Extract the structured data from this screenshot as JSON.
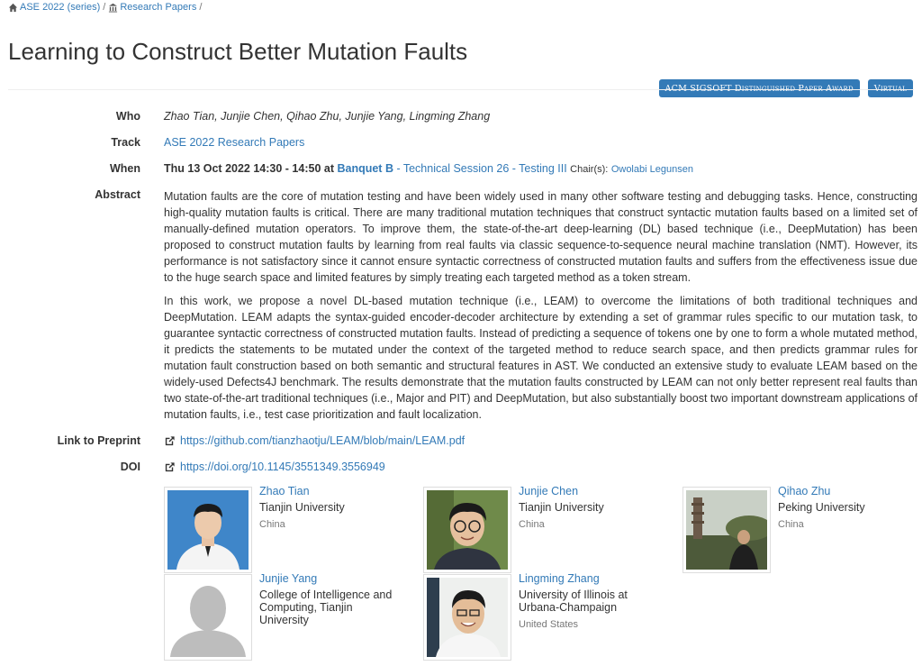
{
  "breadcrumb": {
    "series": "ASE 2022 (series)",
    "sep1": "/",
    "papers": "Research Papers",
    "sep2": "/"
  },
  "title": "Learning to Construct Better Mutation Faults",
  "badges": [
    "ACM SIGSOFT Distinguished Paper Award",
    "Virtual"
  ],
  "fields": {
    "who_label": "Who",
    "who": "Zhao Tian, Junjie Chen, Qihao Zhu, Junjie Yang, Lingming Zhang",
    "track_label": "Track",
    "track": "ASE 2022 Research Papers",
    "when_label": "When",
    "when_date": "Thu 13 Oct 2022 14:30 - 14:50 at",
    "when_room": "Banquet B",
    "when_dash": " - ",
    "when_session": "Technical Session 26 - Testing III",
    "chairs_label": "Chair(s):",
    "chair": "Owolabi Legunsen",
    "abstract_label": "Abstract",
    "preprint_label": "Link to Preprint",
    "preprint_url": "https://github.com/tianzhaotju/LEAM/blob/main/LEAM.pdf",
    "doi_label": "DOI",
    "doi_url": "https://doi.org/10.1145/3551349.3556949"
  },
  "abstract": [
    "Mutation faults are the core of mutation testing and have been widely used in many other software testing and debugging tasks. Hence, constructing high-quality mutation faults is critical. There are many traditional mutation techniques that construct syntactic mutation faults based on a limited set of manually-defined mutation operators. To improve them, the state-of-the-art deep-learning (DL) based technique (i.e., DeepMutation) has been proposed to construct mutation faults by learning from real faults via classic sequence-to-sequence neural machine translation (NMT). However, its performance is not satisfactory since it cannot ensure syntactic correctness of constructed mutation faults and suffers from the effectiveness issue due to the huge search space and limited features by simply treating each targeted method as a token stream.",
    "In this work, we propose a novel DL-based mutation technique (i.e., LEAM) to overcome the limitations of both traditional techniques and DeepMutation. LEAM adapts the syntax-guided encoder-decoder architecture by extending a set of grammar rules specific to our mutation task, to guarantee syntactic correctness of constructed mutation faults. Instead of predicting a sequence of tokens one by one to form a whole mutated method, it predicts the statements to be mutated under the context of the targeted method to reduce search space, and then predicts grammar rules for mutation fault construction based on both semantic and structural features in AST. We conducted an extensive study to evaluate LEAM based on the widely-used Defects4J benchmark. The results demonstrate that the mutation faults constructed by LEAM can not only better represent real faults than two state-of-the-art traditional techniques (i.e., Major and PIT) and DeepMutation, but also substantially boost two important downstream applications of mutation faults, i.e., test case prioritization and fault localization."
  ],
  "people": [
    {
      "name": "Zhao Tian",
      "affiliation": "Tianjin University",
      "country": "China"
    },
    {
      "name": "Junjie Chen",
      "affiliation": "Tianjin University",
      "country": "China"
    },
    {
      "name": "Qihao Zhu",
      "affiliation": "Peking University",
      "country": "China"
    },
    {
      "name": "Junjie Yang",
      "affiliation": "College of Intelligence and Computing, Tianjin University",
      "country": ""
    },
    {
      "name": "Lingming Zhang",
      "affiliation": "University of Illinois at Urbana-Champaign",
      "country": "United States"
    }
  ],
  "icons": {
    "home": "home-icon",
    "university": "university-icon",
    "external": "external-link-icon"
  },
  "colors": {
    "link": "#337ab7",
    "badge_bg": "#337ab7",
    "text": "#333333",
    "muted": "#777777"
  }
}
